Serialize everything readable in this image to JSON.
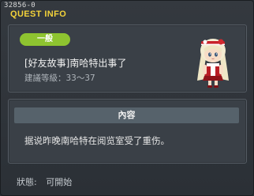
{
  "window": {
    "quest_id": "32856-0",
    "title": "QUEST INFO"
  },
  "quest": {
    "category": "一般",
    "name": "[好友故事]南哈特出事了",
    "level_label": "建議等級：33～37"
  },
  "content": {
    "header": "內容",
    "text": "据说昨晚南哈特在阅览室受了重伤。"
  },
  "status": {
    "label": "狀態:",
    "value": "可開始"
  },
  "colors": {
    "title": "#f3d23a",
    "badge": "#8ec430",
    "panel": "#3a4047"
  }
}
